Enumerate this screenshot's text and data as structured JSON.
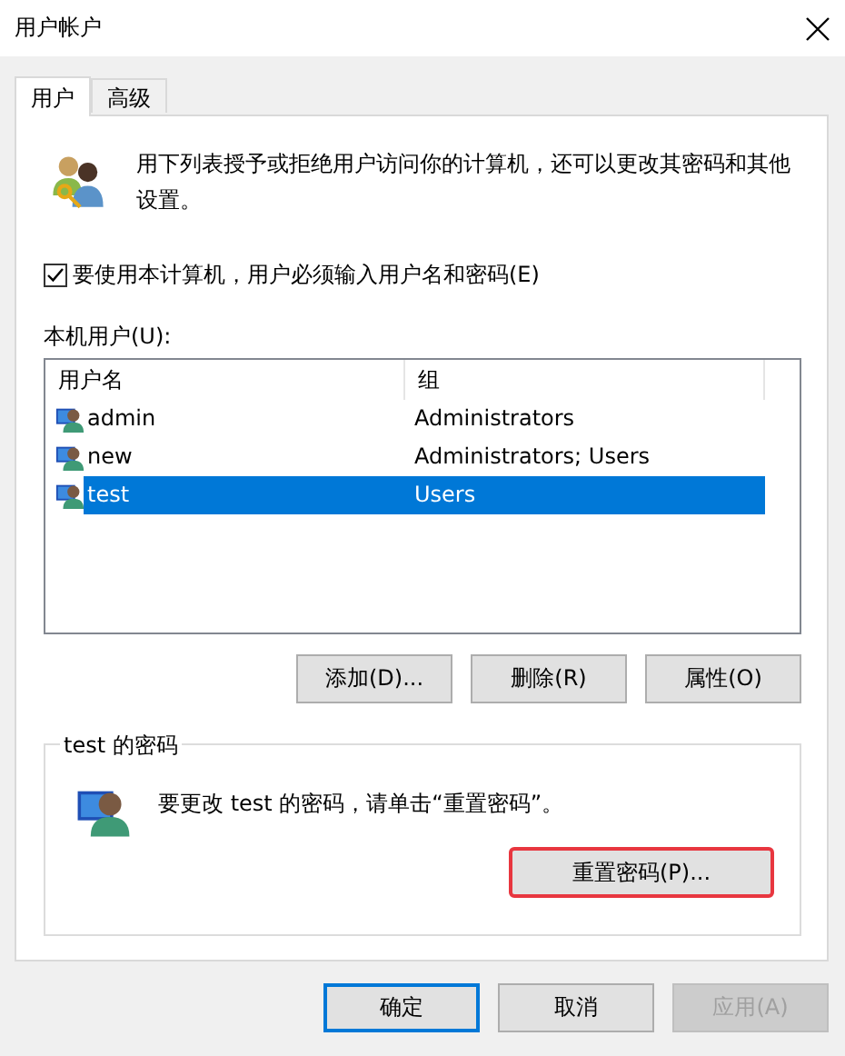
{
  "window": {
    "title": "用户帐户"
  },
  "tabs": [
    {
      "label": "用户",
      "selected": true
    },
    {
      "label": "高级",
      "selected": false
    }
  ],
  "intro": "用下列表授予或拒绝用户访问你的计算机，还可以更改其密码和其他设置。",
  "require_login": {
    "label": "要使用本计算机，用户必须输入用户名和密码(E)",
    "checked": true
  },
  "users_label": "本机用户(U):",
  "table": {
    "columns": [
      "用户名",
      "组"
    ],
    "rows": [
      {
        "name": "admin",
        "group": "Administrators",
        "selected": false
      },
      {
        "name": "new",
        "group": "Administrators; Users",
        "selected": false
      },
      {
        "name": "test",
        "group": "Users",
        "selected": true
      }
    ]
  },
  "list_buttons": [
    "添加(D)...",
    "删除(R)",
    "属性(O)"
  ],
  "password_group": {
    "title": "test 的密码",
    "text": "要更改 test 的密码，请单击“重置密码”。",
    "button": {
      "label": "重置密码(P)...",
      "highlighted": true
    }
  },
  "buttons": [
    {
      "label": "确定",
      "kind": "default",
      "disabled": false
    },
    {
      "label": "取消",
      "kind": "normal",
      "disabled": false
    },
    {
      "label": "应用(A)",
      "kind": "normal",
      "disabled": true
    }
  ]
}
